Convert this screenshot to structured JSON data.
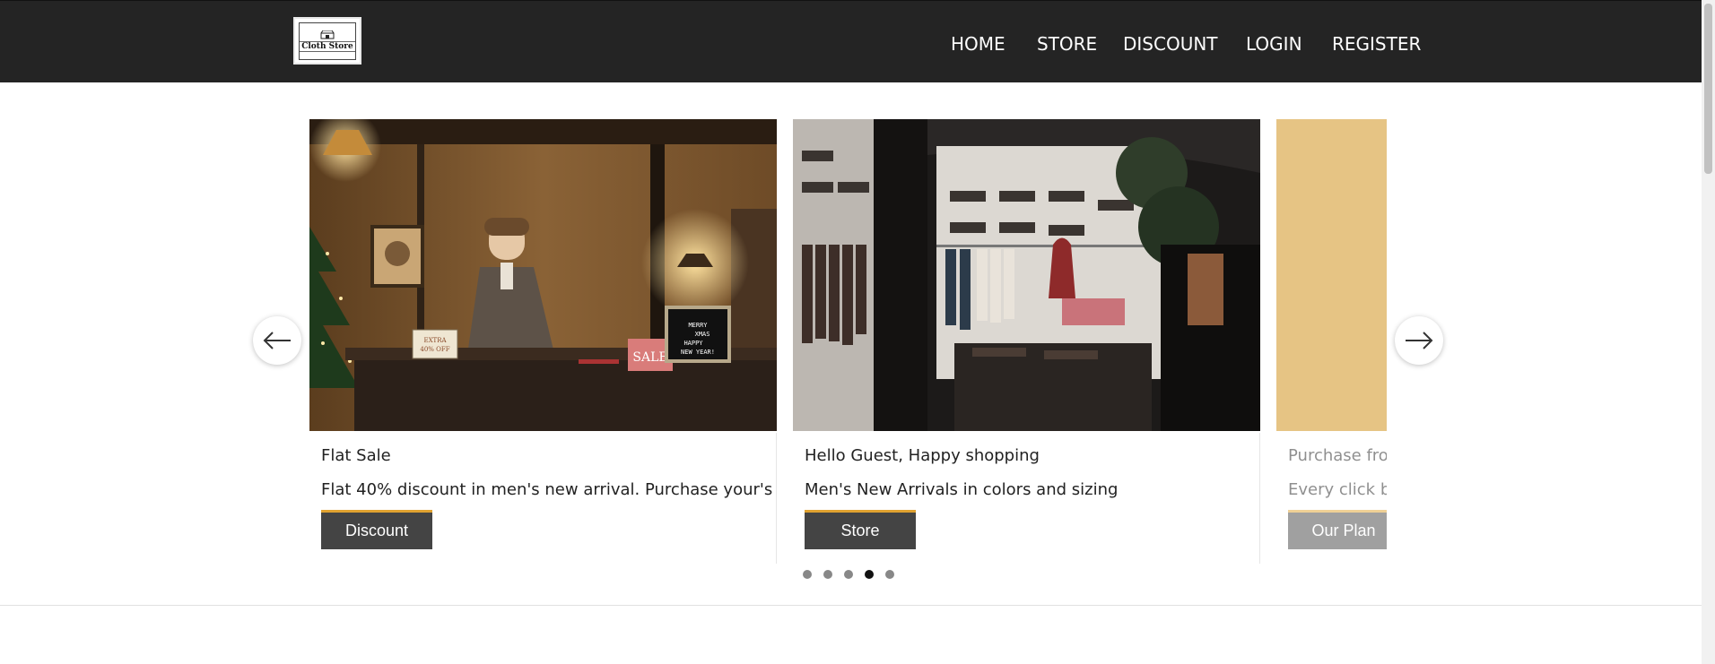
{
  "brand": {
    "logo_text": "Cloth Store"
  },
  "nav": {
    "home": "HOME",
    "store": "STORE",
    "discount": "DISCOUNT",
    "login": "LOGIN",
    "register": "REGISTER"
  },
  "slides": [
    {
      "title": "Flat Sale",
      "description": "Flat 40% discount in men's new arrival. Purchase your's",
      "button": "Discount",
      "sign_sale": "SALE",
      "sign_xmas": "MERRY XMAS HAPPY NEW YEAR!",
      "sign_extra": "EXTRA 40% OFF"
    },
    {
      "title": "Hello Guest, Happy shopping",
      "description": "Men's New Arrivals in colors and sizing",
      "button": "Store"
    },
    {
      "title": "Purchase from",
      "description": "Every click brir",
      "button": "Our Plan"
    }
  ],
  "carousel": {
    "total_slides": 5,
    "active_index": 3
  },
  "colors": {
    "navbar": "#242424",
    "button": "#444444",
    "button_accent": "#e0a230",
    "slide3_bg": "#e6c484"
  },
  "icons": {
    "prev": "arrow-left-icon",
    "next": "arrow-right-icon"
  }
}
